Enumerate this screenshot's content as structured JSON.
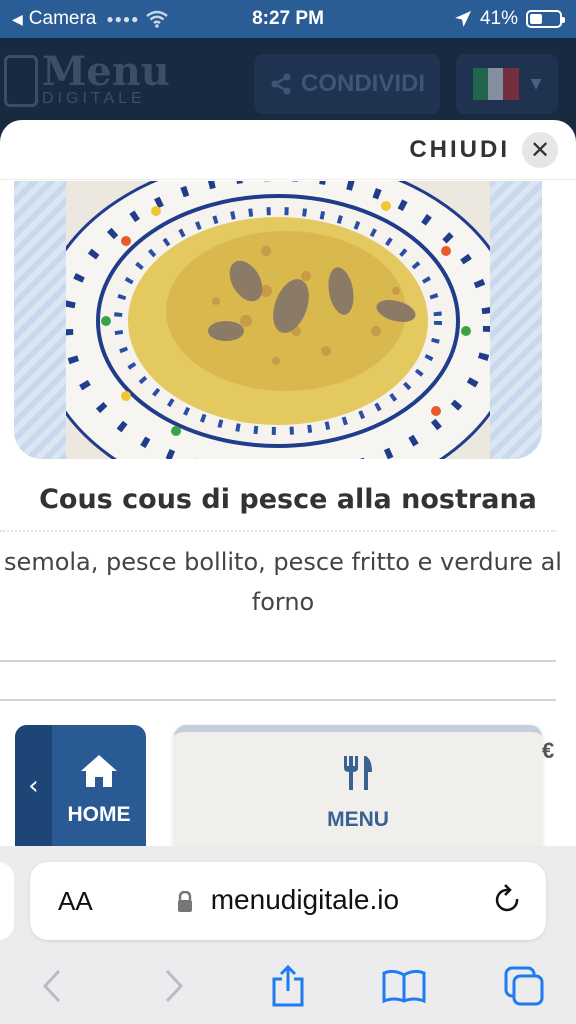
{
  "status_bar": {
    "back_app": "Camera",
    "time": "8:27 PM",
    "battery": "41%"
  },
  "header": {
    "logo_top": "Menu",
    "logo_bottom": "DIGITALE",
    "share_label": "CONDIVIDI",
    "language_flag": "italy-flag"
  },
  "modal": {
    "close_label": "CHIUDI",
    "dish_title": "Cous cous di pesce alla nostrana",
    "dish_description": "semola, pesce bollito, pesce fritto e verdure al forno"
  },
  "bottom_nav": {
    "home_label": "HOME",
    "menu_label": "MENU",
    "price_peek": "€"
  },
  "safari": {
    "aa_label": "AA",
    "url": "menudigitale.io"
  },
  "colors": {
    "status_bar": "#2a5c96",
    "accent_blue": "#2a5a93",
    "menu_blue": "#3a6194",
    "modal_bg": "#ffffff"
  }
}
